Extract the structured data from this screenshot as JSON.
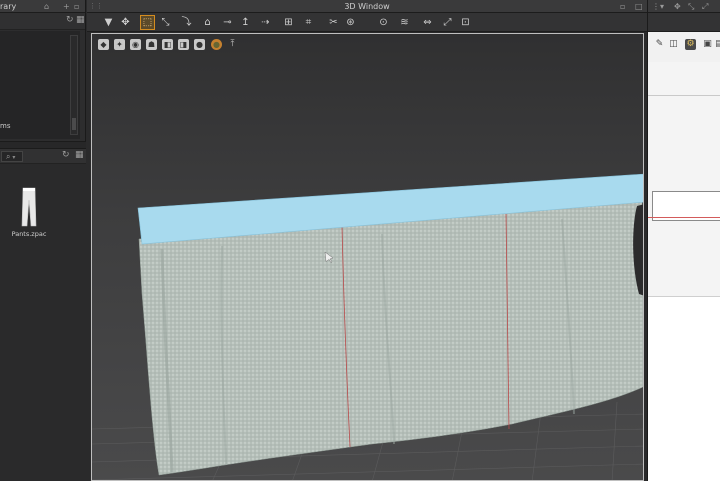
{
  "left_panel": {
    "tab_title": "rary",
    "tree_item_label": "ms",
    "file_item": {
      "name": "Pants.zpac",
      "icon": "pants-icon"
    }
  },
  "window": {
    "title": "3D Window"
  },
  "toolbar": {
    "icons": [
      "arrow-down-icon",
      "move-icon",
      "select-box-icon",
      "transform-icon",
      "fold-icon",
      "hanger-icon",
      "pin-icon",
      "tack-icon",
      "brush-icon",
      "stitch-icon",
      "measure-icon",
      "cut-icon",
      "sewing-icon",
      "button-icon",
      "tape-icon",
      "zipper-icon",
      "avatar-pin-icon"
    ],
    "active_index": 2
  },
  "viewport": {
    "icons": [
      "shaded-view-icon",
      "texture-view-icon",
      "avatar-view-icon",
      "body-icon",
      "garment-icon",
      "fabric-icon",
      "figure-icon",
      "sphere-icon",
      "screenshot-icon"
    ]
  },
  "scene": {
    "colors": {
      "fabric": "#b9c3bd",
      "band": "#a6d9ee",
      "seam": "#b84a4a",
      "grid": "#5a5a5b"
    }
  }
}
